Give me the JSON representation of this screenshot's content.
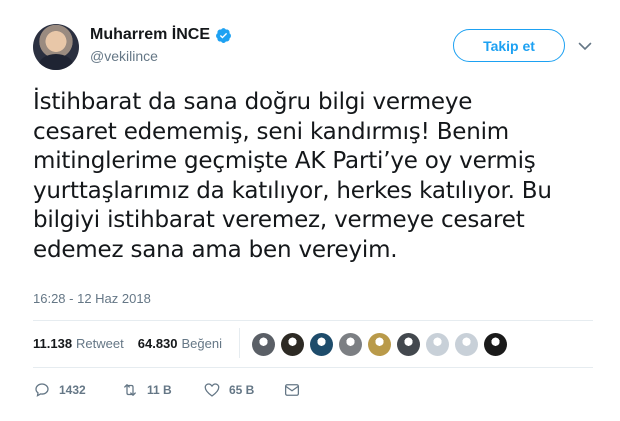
{
  "author": {
    "display_name": "Muharrem İNCE",
    "handle": "@vekilince",
    "verified": true
  },
  "follow_button_label": "Takip et",
  "tweet": {
    "text": "İstihbarat da sana doğru bilgi vermeye\ncesaret edememiş, seni kandırmış! Benim\nmitinglerime geçmişte AK Parti’ye oy vermiş\nyurttaşlarımız da katılıyor, herkes katılıyor. Bu\nbilgiyi istihbarat veremez, vermeye cesaret\nedemez sana ama ben vereyim.",
    "timestamp": "16:28 - 12 Haz 2018"
  },
  "stats": {
    "retweets_count": "11.138",
    "retweets_label": "Retweet",
    "likes_count": "64.830",
    "likes_label": "Beğeni"
  },
  "likers": [
    {
      "color": "#5a5f66"
    },
    {
      "color": "#2d2a24"
    },
    {
      "color": "#1e4c6b"
    },
    {
      "color": "#7c7f83"
    },
    {
      "color": "#b99a4a"
    },
    {
      "color": "#43484e"
    },
    {
      "color": "#c8d0d8"
    },
    {
      "color": "#c8d0d8"
    },
    {
      "color": "#1a1a1a"
    }
  ],
  "actions": {
    "reply_count": "1432",
    "retweet_count": "11 B",
    "like_count": "65 B"
  },
  "colors": {
    "accent": "#1da1f2",
    "text": "#14171a",
    "muted": "#657786"
  },
  "icons": [
    "verified-icon",
    "chevron-down-icon",
    "reply-icon",
    "retweet-icon",
    "heart-icon",
    "message-icon"
  ]
}
